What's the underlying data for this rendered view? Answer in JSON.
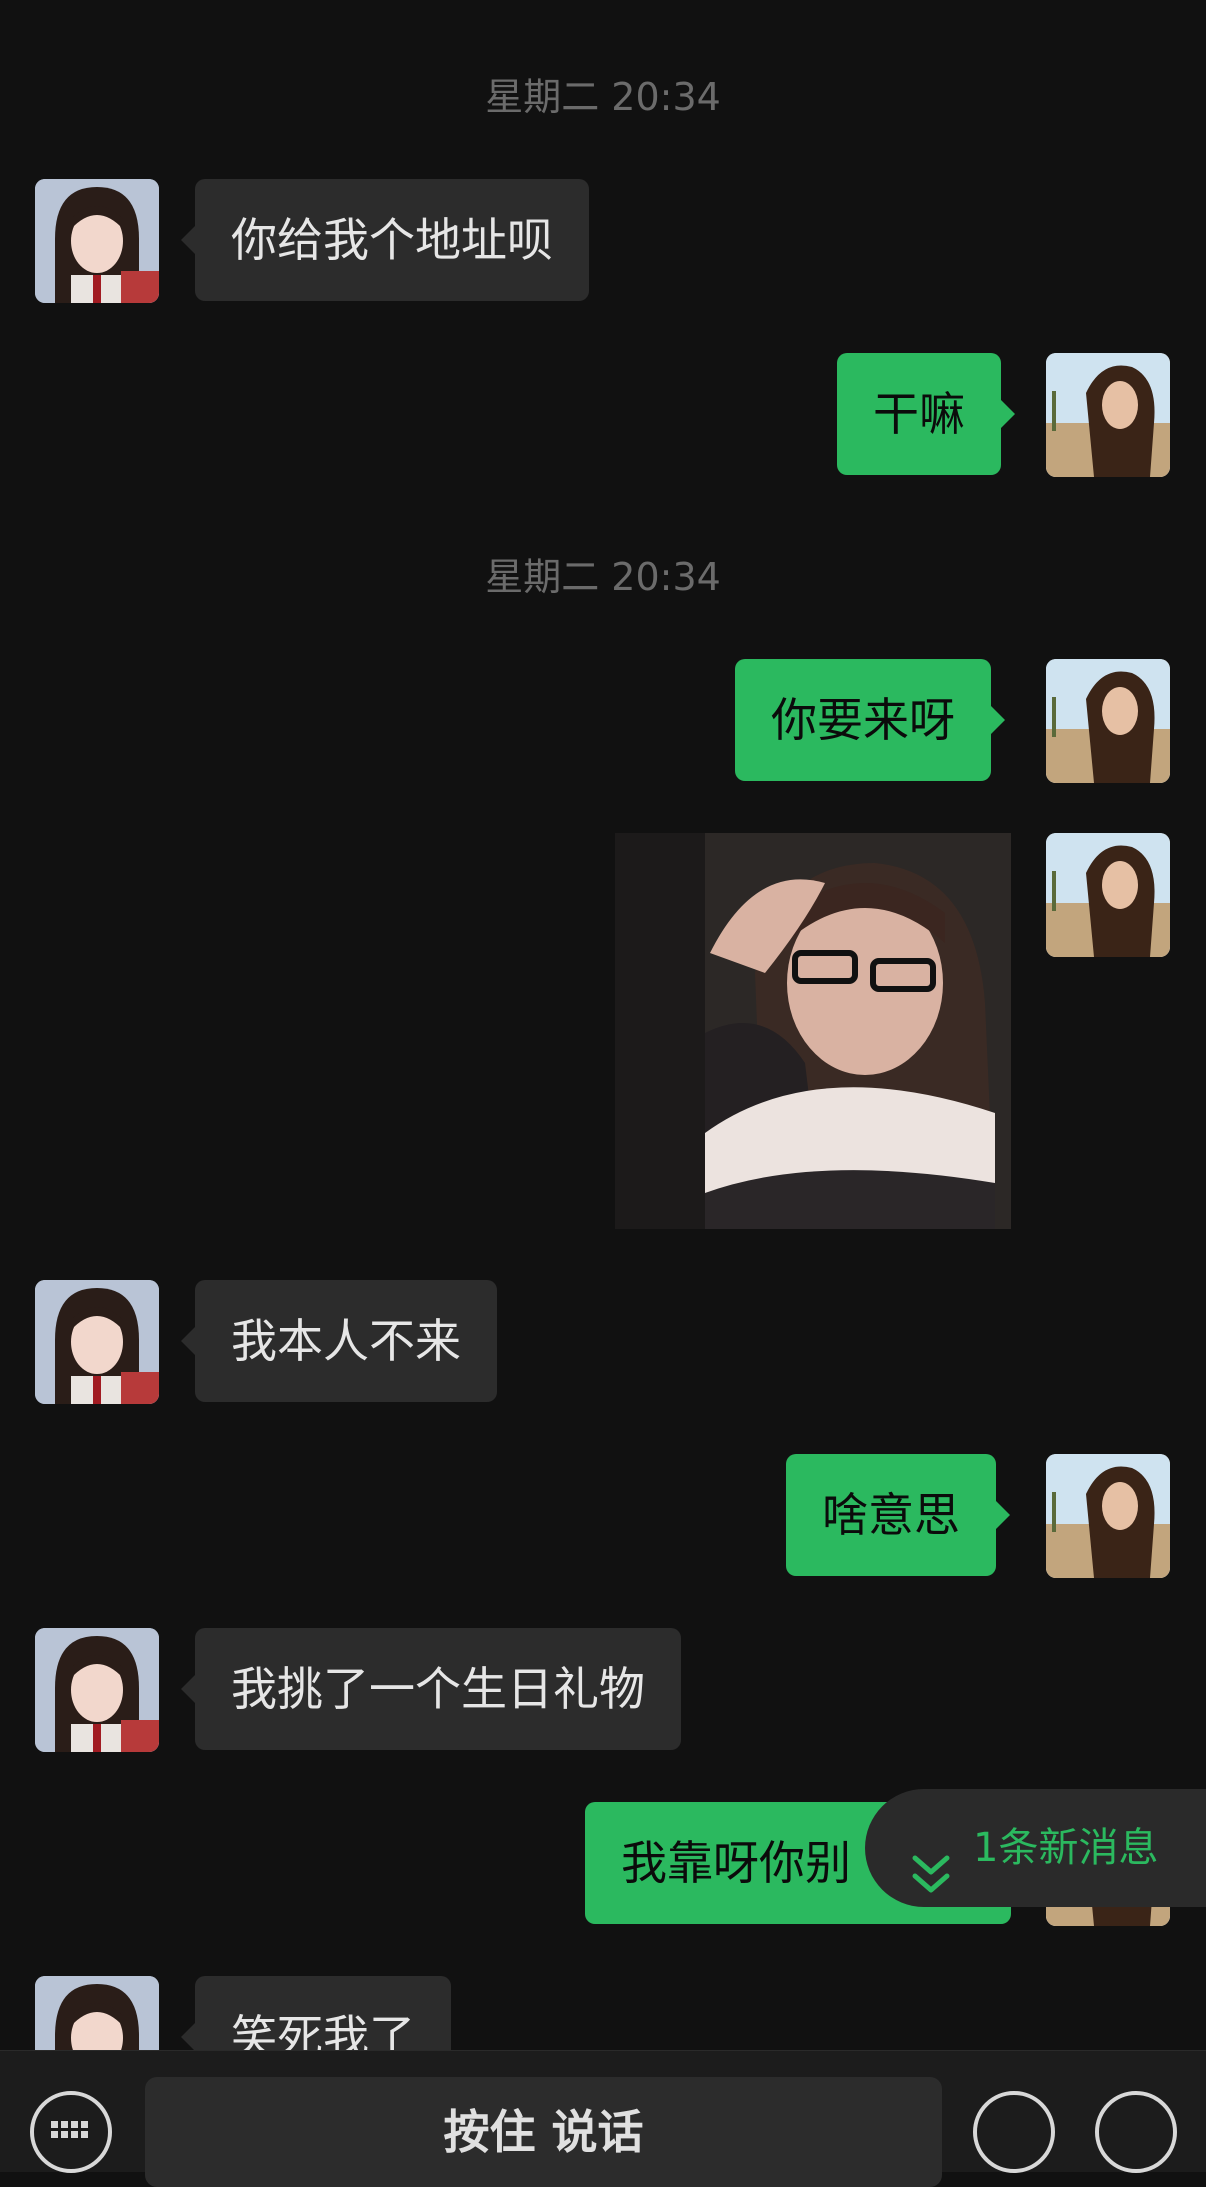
{
  "timestamps": [
    "星期二 20:34",
    "星期二 20:34"
  ],
  "messages": {
    "m1": "你给我个地址呗",
    "m2": "干嘛",
    "m3": "你要来呀",
    "m5": "我本人不来",
    "m6": "啥意思",
    "m7": "我挑了一个生日礼物",
    "m8": "我靠呀你别",
    "m9": "笑死我了"
  },
  "new_message_pill": "1条新消息",
  "input_bar": {
    "hold_to_talk": "按住 说话"
  },
  "colors": {
    "background": "#111111",
    "outgoing_bubble": "#2bb95f",
    "incoming_bubble": "#2c2c2c",
    "accent": "#2bb95f"
  },
  "icons": [
    "keyboard-icon",
    "emoji-icon",
    "plus-icon",
    "chevron-double-down-icon"
  ]
}
